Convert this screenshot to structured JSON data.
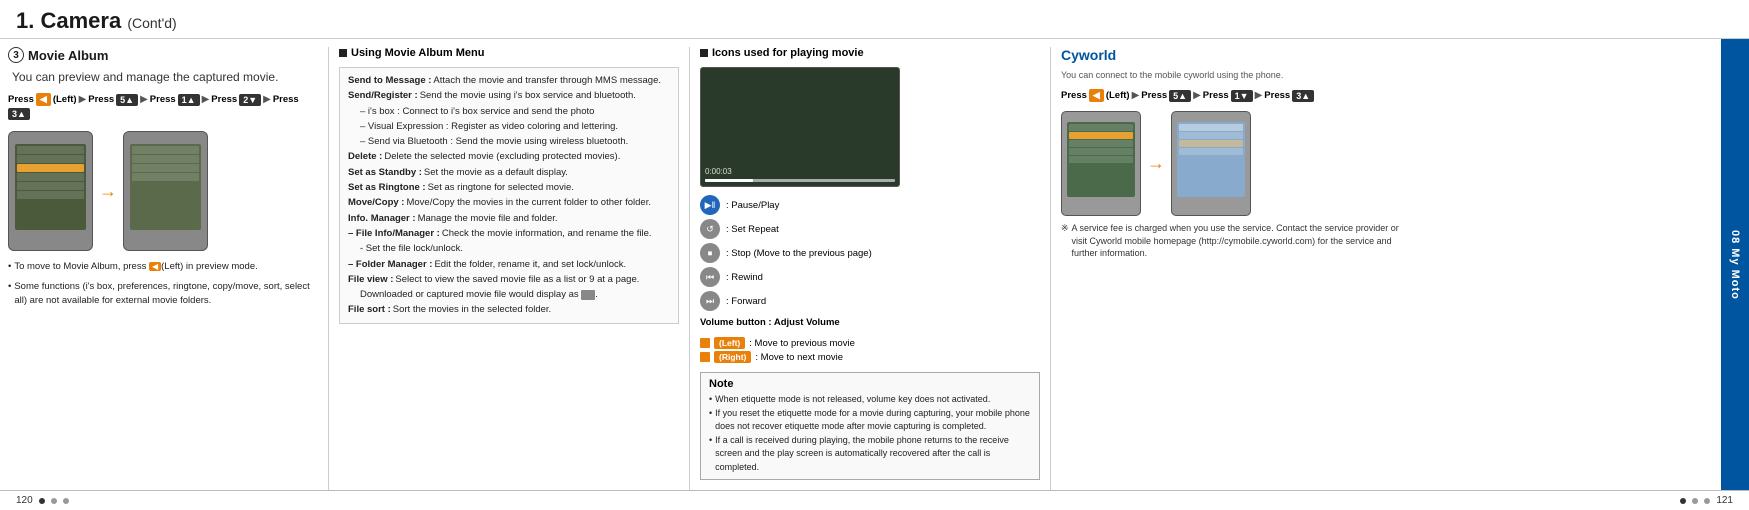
{
  "header": {
    "chapter": "1.",
    "title": "Camera",
    "subtitle": "(Cont'd)"
  },
  "sidebar": {
    "label": "08 My Moto"
  },
  "col1": {
    "section_num": "❸",
    "section_name": "Movie Album",
    "section_desc": "You can preview and manage the captured movie.",
    "press_sequence": "Press (Left) ▶ Press ▶ Press ▶ Press ▶ Press",
    "bullets": [
      "To move to Movie Album, press (Left) in preview mode.",
      "Some functions (i's box, preferences, ringtone, copy/move, sort, select all) are not available for external movie folders."
    ]
  },
  "col2": {
    "section_name": "Using Movie Album Menu",
    "menu_items": [
      {
        "label": "Send to Message :",
        "text": "Attach the movie and transfer through MMS message."
      },
      {
        "label": "Send/Register :",
        "text": "Send the movie using i's box service and bluetooth."
      },
      {
        "sub": "– i's box : Connect to i's box service and send the photo"
      },
      {
        "sub": "– Visual Expression : Register as video coloring and lettering."
      },
      {
        "sub": "– Send via Bluetooth : Send the movie using wireless bluetooth."
      },
      {
        "label": "Delete :",
        "text": "Delete the selected movie (excluding protected movies)."
      },
      {
        "label": "Set as Standby :",
        "text": "Set the movie as a default display."
      },
      {
        "label": "Set as Ringtone :",
        "text": "Set as ringtone for selected movie."
      },
      {
        "label": "Move/Copy :",
        "text": "Move/Copy the movies in the current folder to other folder."
      },
      {
        "label": "Info. Manager :",
        "text": "Manage the movie file and folder."
      },
      {
        "label": "– File Info/Manager :",
        "text": "Check the movie information, and rename the file."
      },
      {
        "sub": "- Set the file lock/unlock."
      },
      {
        "label": "– Folder Manager :",
        "text": "Edit the folder, rename it, and set lock/unlock."
      },
      {
        "label": "File view :",
        "text": "Select to view the saved movie file as a list or 9 at a page."
      },
      {
        "sub": "Downloaded or captured movie file would display as   ."
      },
      {
        "label": "File sort :",
        "text": "Sort the movies in the selected folder."
      }
    ]
  },
  "col3": {
    "section_name": "Icons used for playing movie",
    "icons": [
      {
        "label": "Pause/Play"
      },
      {
        "label": "Set Repeat"
      },
      {
        "label": "Stop (Move to the previous page)"
      },
      {
        "label": "Rewind"
      },
      {
        "label": "Forward"
      }
    ],
    "volume_label": "Volume button :  Adjust Volume",
    "nav_keys": [
      {
        "key": "(Left)",
        "text": "Move to previous movie"
      },
      {
        "key": "(Right)",
        "text": "Move to next movie"
      }
    ],
    "note": {
      "title": "Note",
      "items": [
        "When etiquette mode is not released, volume key does not activated.",
        "If you reset the etiquette mode for a movie during capturing, your mobile phone does not recover etiquette mode after movie capturing is completed.",
        "If a call is received during playing, the mobile phone returns to the receive screen and the play screen is automatically recovered after the call is completed."
      ]
    }
  },
  "col4": {
    "title": "Cyworld",
    "desc": "You can connect to the mobile cyworld using the phone.",
    "press_sequence": "Press (Left) ▶ Press ▶ Press ▶ Press",
    "asterisk_note": "A service fee is charged when you use the service. Contact the service provider or visit Cyworld mobile homepage (http://cymobile.cyworld.com) for the service and further information."
  },
  "footer": {
    "left_page": "120",
    "right_page": "121",
    "left_dots": [
      "active",
      "inactive",
      "inactive"
    ],
    "right_dots": [
      "active",
      "inactive",
      "inactive"
    ]
  }
}
